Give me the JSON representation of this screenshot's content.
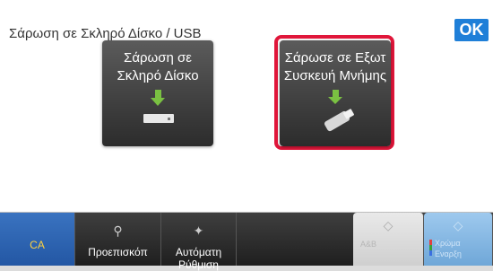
{
  "header": {
    "title": "Σάρωση σε Σκληρό Δίσκο / USB",
    "ok_label": "OK"
  },
  "options": {
    "hdd_line1": "Σάρωση σε",
    "hdd_line2": "Σκληρό Δίσκο",
    "usb_line1": "Σάρωσε σε Εξωτ",
    "usb_line2": "Συσκευή Μνήμης"
  },
  "bottombar": {
    "ca_label": "CA",
    "preview_label": "Προεπισκόπ",
    "auto_line1": "Αυτόματη",
    "auto_line2": "Ρύθμιση",
    "bw_line1": "A&B",
    "color_line1": "Χρώμα",
    "color_line2": "Εναρξη"
  },
  "colors": {
    "accent": "#1f7fd8",
    "selection": "#e0163a",
    "arrow": "#7ac142",
    "ca_text": "#ffd23f"
  }
}
